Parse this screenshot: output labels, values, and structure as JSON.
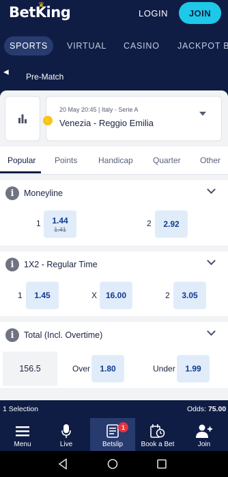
{
  "header": {
    "logo": "BetKing",
    "login_label": "LOGIN",
    "join_label": "JOIN"
  },
  "nav": {
    "tabs": [
      "SPORTS",
      "VIRTUAL",
      "CASINO",
      "JACKPOT BE"
    ]
  },
  "prematch": {
    "label": "Pre-Match"
  },
  "match": {
    "meta": "20 May 20:45 | Italy - Serie A",
    "name": "Venezia - Reggio Emilia"
  },
  "market_tabs": [
    "Popular",
    "Points",
    "Handicap",
    "Quarter",
    "Other"
  ],
  "markets": {
    "moneyline": {
      "title": "Moneyline",
      "sel1_label": "1",
      "sel1_odd": "1.44",
      "sel1_old_odd": "1.41",
      "sel2_label": "2",
      "sel2_odd": "2.92"
    },
    "x12": {
      "title": "1X2 - Regular Time",
      "sel1_label": "1",
      "sel1_odd": "1.45",
      "selx_label": "X",
      "selx_odd": "16.00",
      "sel2_label": "2",
      "sel2_odd": "3.05"
    },
    "total": {
      "title": "Total (Incl. Overtime)",
      "line": "156.5",
      "over_label": "Over",
      "over_odd": "1.80",
      "under_label": "Under",
      "under_odd": "1.99"
    }
  },
  "betslip_bar": {
    "selection_count": "1 Selection",
    "odds_label": "Odds:",
    "odds_value": "75.00"
  },
  "bottom_nav": {
    "menu": "Menu",
    "live": "Live",
    "betslip": "Betslip",
    "betslip_badge": "1",
    "book": "Book a Bet",
    "join": "Join"
  },
  "colors": {
    "brand_navy": "#0f1d45",
    "accent_cyan": "#1ec8e8",
    "odd_bg": "#e1ecfb",
    "badge_red": "#e53342"
  }
}
